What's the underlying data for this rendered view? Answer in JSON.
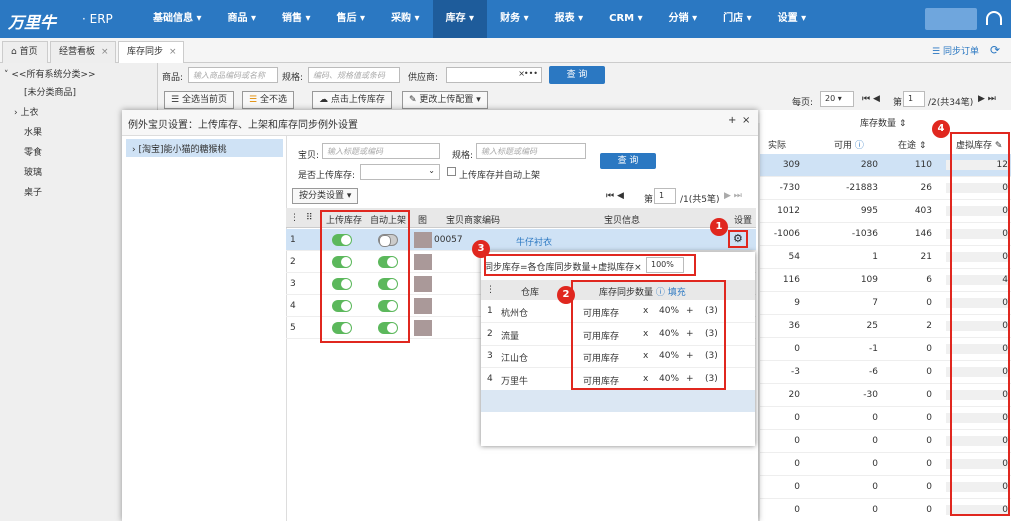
{
  "app": {
    "logo": "万里牛",
    "suffix": "· ERP"
  },
  "nav": [
    "基础信息",
    "商品",
    "销售",
    "售后",
    "采购",
    "库存",
    "财务",
    "报表",
    "CRM",
    "分销",
    "门店",
    "设置"
  ],
  "tabs": [
    {
      "label": "首页",
      "icon": "home-icon"
    },
    {
      "label": "经营看板"
    },
    {
      "label": "库存同步"
    }
  ],
  "topright": {
    "sync_order": "同步订单"
  },
  "sidebar": {
    "root": "<<所有系统分类>>",
    "items": [
      "[未分类商品]",
      "上衣",
      "水果",
      "零食",
      "玻璃",
      "桌子"
    ]
  },
  "filters": {
    "product_label": "商品:",
    "product_ph": "输入商品编码或名称",
    "spec_label": "规格:",
    "spec_ph": "编码、规格值或条码",
    "supplier_label": "供应商:",
    "query": "查 询"
  },
  "toolbar": {
    "select_page": "全选当前页",
    "deselect": "全不选",
    "upload": "点击上传库存",
    "config": "更改上传配置"
  },
  "pager": {
    "per_page_label": "每页:",
    "per_page": "20",
    "page_label": "第",
    "page": "1",
    "total": "/2(共34笔)"
  },
  "right_table": {
    "group": "库存数量",
    "cols": [
      "实际",
      "可用",
      "在途",
      "虚拟库存"
    ],
    "rows": [
      [
        "309",
        "280",
        "110",
        "12"
      ],
      [
        "-730",
        "-21883",
        "26",
        "0"
      ],
      [
        "1012",
        "995",
        "403",
        "0"
      ],
      [
        "-1006",
        "-1036",
        "146",
        "0"
      ],
      [
        "54",
        "1",
        "21",
        "0"
      ],
      [
        "116",
        "109",
        "6",
        "4"
      ],
      [
        "9",
        "7",
        "0",
        "0"
      ],
      [
        "36",
        "25",
        "2",
        "0"
      ],
      [
        "0",
        "-1",
        "0",
        "0"
      ],
      [
        "-3",
        "-6",
        "0",
        "0"
      ],
      [
        "20",
        "-30",
        "0",
        "0"
      ],
      [
        "0",
        "0",
        "0",
        "0"
      ],
      [
        "0",
        "0",
        "0",
        "0"
      ],
      [
        "0",
        "0",
        "0",
        "0"
      ],
      [
        "0",
        "0",
        "0",
        "0"
      ],
      [
        "0",
        "0",
        "0",
        "0"
      ]
    ]
  },
  "modal": {
    "title": "例外宝贝设置：上传库存、上架和库存同步例外设置",
    "store": "[淘宝]能小猫的糖猴桃",
    "baby_label": "宝贝:",
    "baby_ph": "输入标题或编码",
    "spec_label": "规格:",
    "spec_ph": "输入标题或编码",
    "upload_label": "是否上传库存:",
    "auto_label": "上传库存并自动上架",
    "query": "查 询",
    "category_btn": "按分类设置",
    "page_label": "第",
    "page": "1",
    "total": "/1(共5笔)",
    "cols": {
      "upload": "上传库存",
      "auto": "自动上架",
      "img": "图",
      "code": "宝贝商家编码",
      "info": "宝贝信息",
      "setting": "设置"
    },
    "rows": [
      {
        "num": "1",
        "code": "00057",
        "info": "牛仔衬衣",
        "upload_on": true,
        "auto_on": false
      },
      {
        "num": "2",
        "upload_on": true,
        "auto_on": true
      },
      {
        "num": "3",
        "upload_on": true,
        "auto_on": true
      },
      {
        "num": "4",
        "upload_on": true,
        "auto_on": true
      },
      {
        "num": "5",
        "upload_on": true,
        "auto_on": true
      }
    ]
  },
  "popup": {
    "formula": "同步库存=各仓库同步数量+虚拟库存×",
    "percent": "100%",
    "col_wh": "仓库",
    "col_qty": "库存同步数量",
    "fill": "填充",
    "rows": [
      {
        "num": "1",
        "wh": "杭州仓",
        "type": "可用库存",
        "x": "x",
        "pct": "40%",
        "plus": "+",
        "add": "(3)"
      },
      {
        "num": "2",
        "wh": "流量",
        "type": "可用库存",
        "x": "x",
        "pct": "40%",
        "plus": "+",
        "add": "(3)"
      },
      {
        "num": "3",
        "wh": "江山仓",
        "type": "可用库存",
        "x": "x",
        "pct": "40%",
        "plus": "+",
        "add": "(3)"
      },
      {
        "num": "4",
        "wh": "万里牛",
        "type": "可用库存",
        "x": "x",
        "pct": "40%",
        "plus": "+",
        "add": "(3)"
      }
    ]
  },
  "badges": [
    "1",
    "2",
    "3",
    "4"
  ],
  "colors": {
    "nav": "#2b78c2",
    "toggle_on": "#5cb85c",
    "highlight": "#e0271f"
  }
}
